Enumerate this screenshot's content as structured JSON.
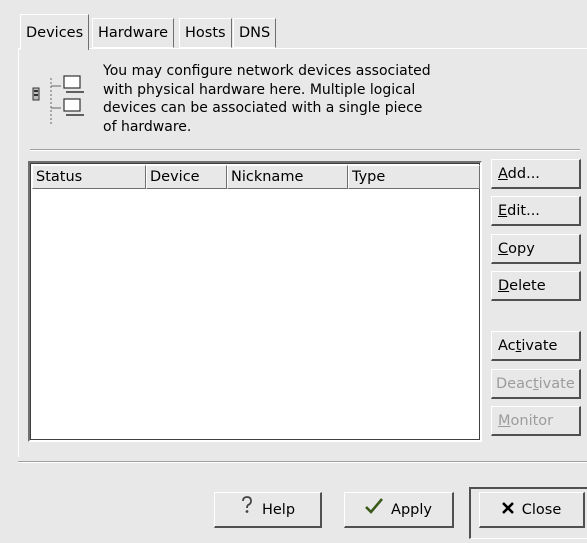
{
  "tabs": [
    {
      "label": "Devices",
      "active": true
    },
    {
      "label": "Hardware",
      "active": false
    },
    {
      "label": "Hosts",
      "active": false
    },
    {
      "label": "DNS",
      "active": false
    }
  ],
  "description": "You may configure network devices associated\nwith physical hardware here. Multiple logical\ndevices can be associated with a single piece\nof hardware.",
  "list": {
    "columns": [
      "Status",
      "Device",
      "Nickname",
      "Type"
    ],
    "rows": []
  },
  "side_buttons": {
    "add": {
      "label": "Add...",
      "mnemonic": "A",
      "rest": "dd...",
      "enabled": true
    },
    "edit": {
      "label": "Edit...",
      "mnemonic": "E",
      "rest": "dit...",
      "enabled": true
    },
    "copy": {
      "label": "Copy",
      "mnemonic": "C",
      "rest": "opy",
      "enabled": true
    },
    "delete": {
      "label": "Delete",
      "mnemonic": "D",
      "rest": "elete",
      "enabled": true
    },
    "activate": {
      "label": "Activate",
      "pre": "Ac",
      "mnemonic": "t",
      "rest": "ivate",
      "enabled": true
    },
    "deactivate": {
      "label": "Deactivate",
      "pre": "Deac",
      "mnemonic": "t",
      "rest": "ivate",
      "enabled": false
    },
    "monitor": {
      "label": "Monitor",
      "mnemonic": "M",
      "rest": "onitor",
      "enabled": false
    }
  },
  "bottom_buttons": {
    "help": {
      "label": "Help",
      "icon": "help-icon"
    },
    "apply": {
      "label": "Apply",
      "icon": "checkmark-icon"
    },
    "close": {
      "label": "Close",
      "icon": "x-close-icon"
    }
  },
  "colors": {
    "window_bg": "#e8e8e8",
    "list_bg": "#ffffff",
    "disabled_text": "#9c9c9c"
  }
}
